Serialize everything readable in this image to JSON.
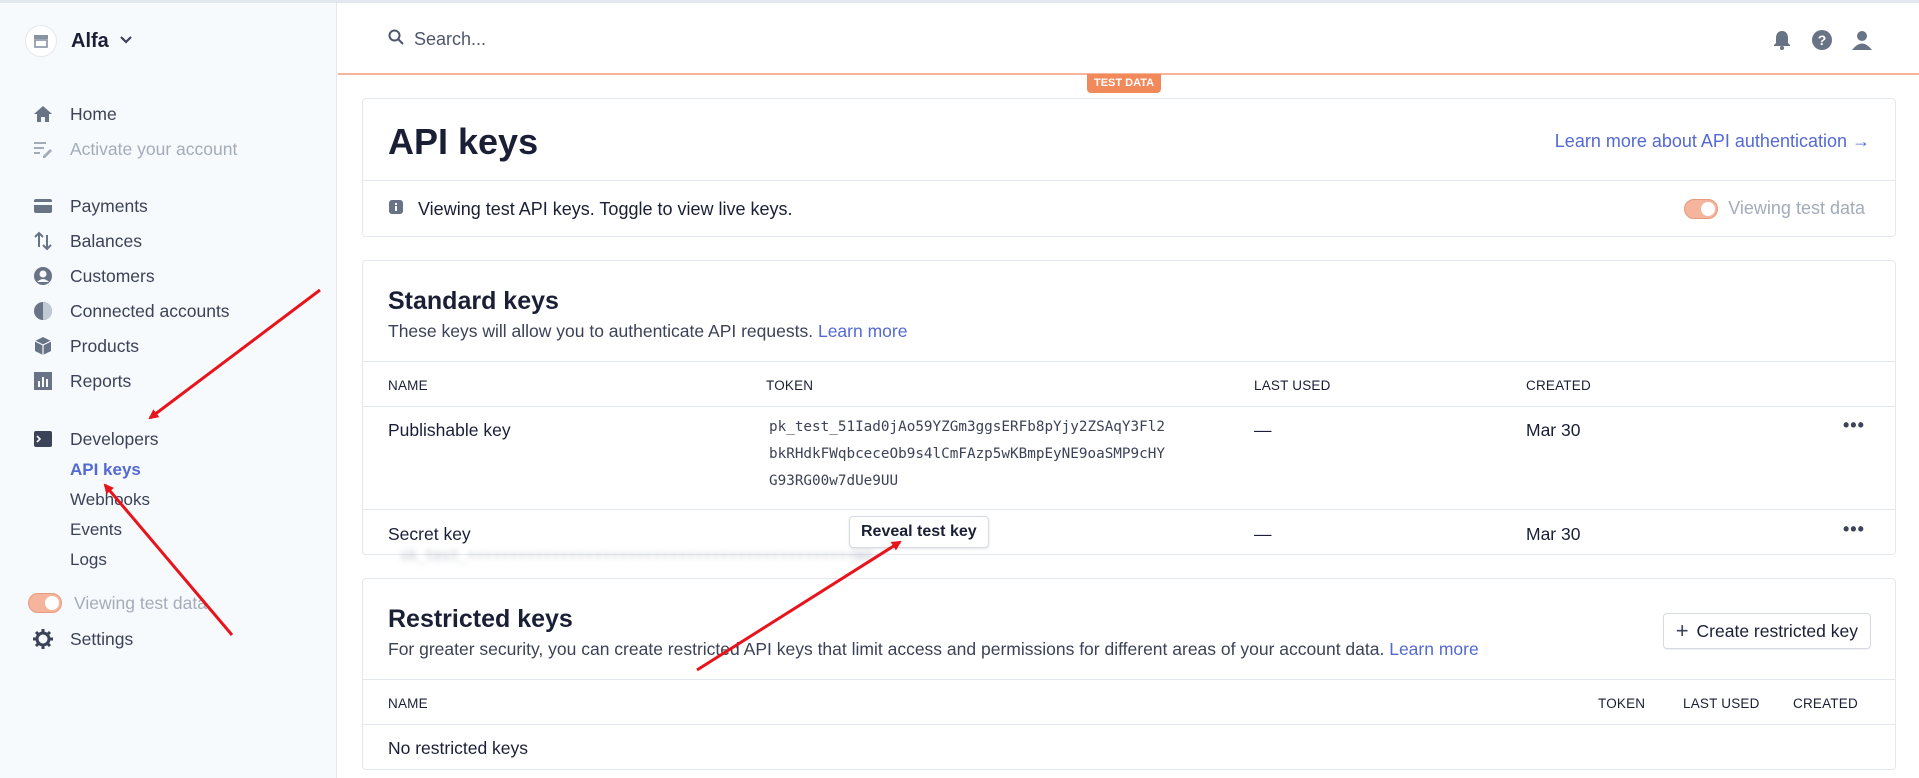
{
  "account": {
    "name": "Alfa"
  },
  "search": {
    "placeholder": "Search..."
  },
  "badge": {
    "test_data": "TEST DATA"
  },
  "sidebar": {
    "home": "Home",
    "activate": "Activate your account",
    "payments": "Payments",
    "balances": "Balances",
    "customers": "Customers",
    "connected": "Connected accounts",
    "products": "Products",
    "reports": "Reports",
    "developers": "Developers",
    "api_keys": "API keys",
    "webhooks": "Webhooks",
    "events": "Events",
    "logs": "Logs",
    "viewing_test": "Viewing test data",
    "settings": "Settings"
  },
  "page": {
    "title": "API keys",
    "auth_link": "Learn more about API authentication →",
    "info": "Viewing test API keys. Toggle to view live keys.",
    "view_toggle": "Viewing test data"
  },
  "standard": {
    "title": "Standard keys",
    "desc": "These keys will allow you to authenticate API requests.",
    "learn_more": "Learn more",
    "headers": {
      "name": "Name",
      "token": "Token",
      "last_used": "Last used",
      "created": "Created"
    },
    "rows": [
      {
        "name": "Publishable key",
        "token_lines": [
          "pk_test_51Iad0jAo59YZGm3ggsERFb8pYjy2ZSAqY3Fl2",
          "bkRHdkFWqbceceOb9s4lCmFAzp5wKBmpEyNE9oaSMP9cHY",
          "G93RG00w7dUe9UU"
        ],
        "last_used": "—",
        "created": "Mar 30"
      },
      {
        "name": "Secret key",
        "reveal": "Reveal test key",
        "last_used": "—",
        "created": "Mar 30"
      }
    ]
  },
  "restricted": {
    "title": "Restricted keys",
    "desc": "For greater security, you can create restricted API keys that limit access and permissions for different areas of your account data.",
    "learn_more": "Learn more",
    "create_button": "Create restricted key",
    "headers": {
      "name": "Name",
      "token": "Token",
      "last_used": "Last used",
      "created": "Created"
    },
    "empty": "No restricted keys"
  },
  "colors": {
    "accent": "#5469d4",
    "test_orange": "#f2895a",
    "annotation_red": "#e8141c"
  }
}
